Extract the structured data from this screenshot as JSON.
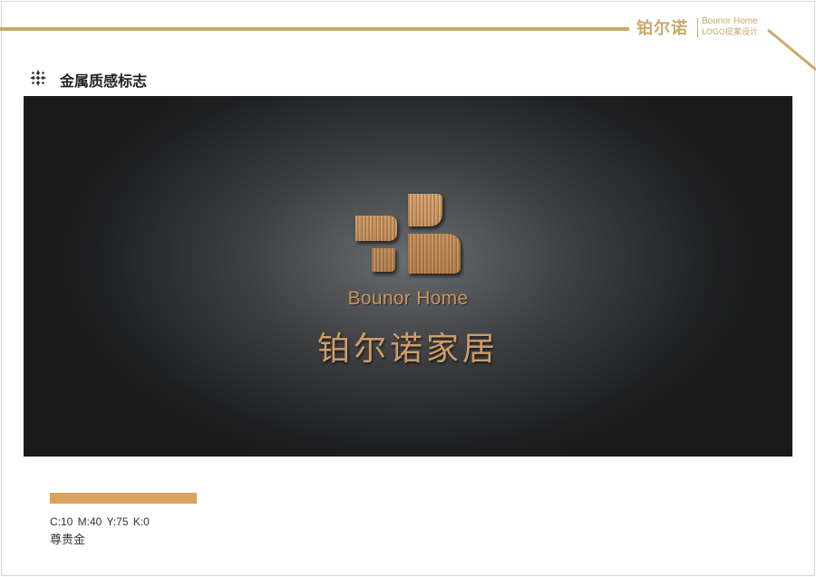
{
  "header": {
    "brand_cn": "铂尔诺",
    "brand_en": "Bounor Home",
    "brand_sub": "LOGO提案设计",
    "accent_color": "#c9a96a"
  },
  "section": {
    "title": "金属质感标志",
    "icon": "ornament-icon"
  },
  "logo": {
    "mark_icon": "brushed-metal-leaf-mark-icon",
    "name_en": "Bounor Home",
    "name_cn": "铂尔诺家居",
    "metal_color": "#c8955e"
  },
  "swatch": {
    "color": "#d8a35e",
    "cmyk": "C:10  M:40  Y:75  K:0",
    "name": "尊贵金"
  }
}
